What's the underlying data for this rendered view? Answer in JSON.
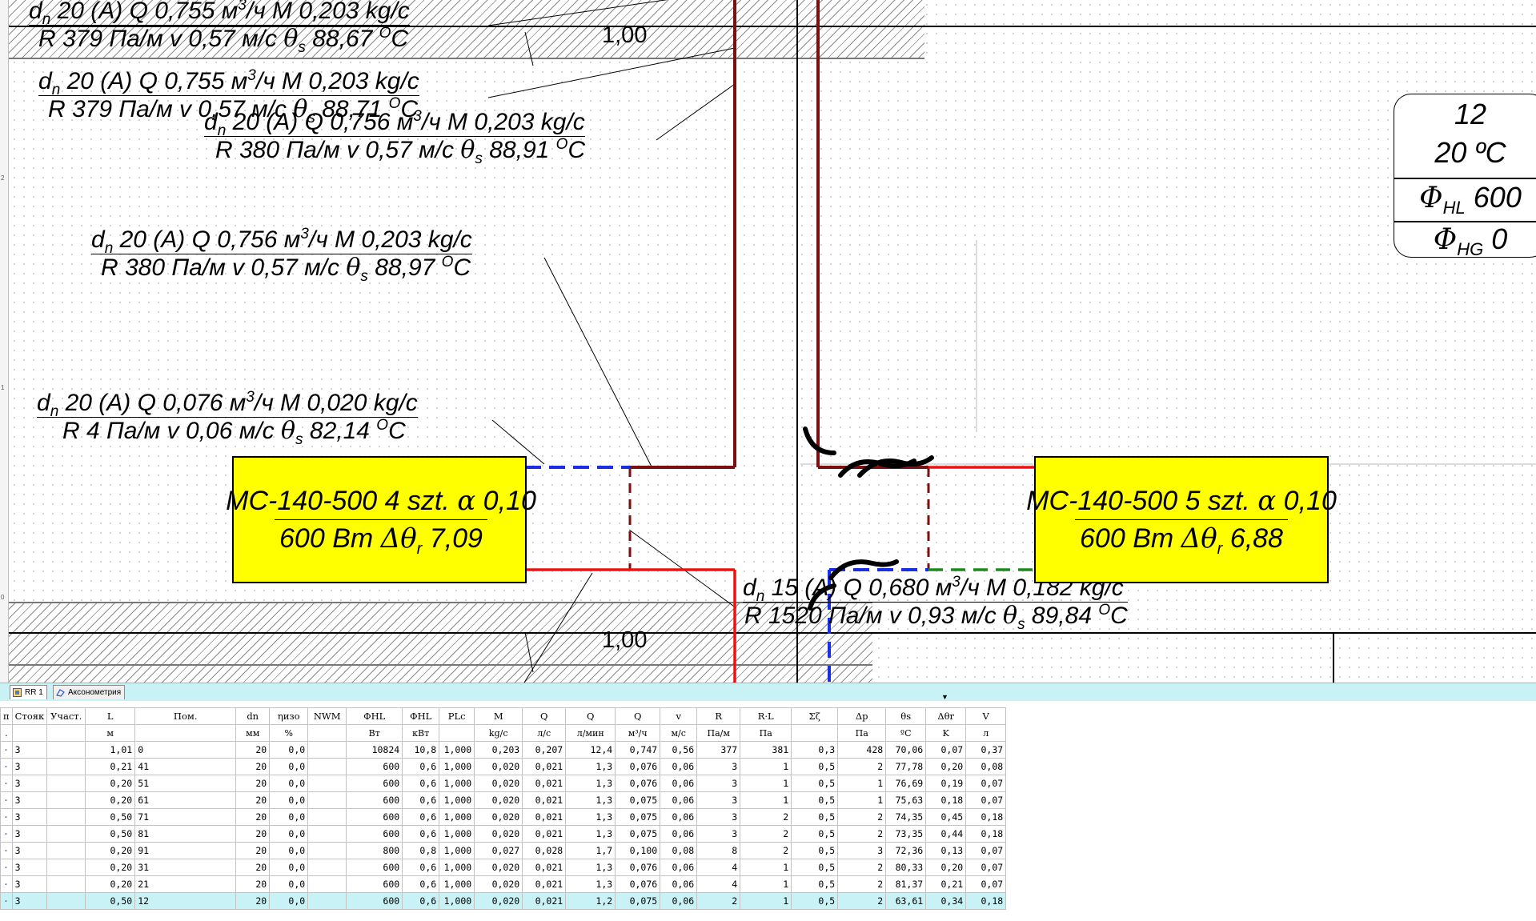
{
  "drawing": {
    "dimension_top": "1,00",
    "dimension_bottom": "1,00",
    "labels": [
      {
        "dn": "d",
        "dn_sub": "n",
        "line1_rest": " 20 (A) Q 0,755 м",
        "sup": "3",
        "line1_tail": "/ч M 0,203 kg/c",
        "line2_a": "R 379 Па/м v 0,57 м/с ",
        "theta_sub": "s",
        "line2_b": " 88,67 ",
        "deg": "O",
        "line2_c": "C"
      },
      {
        "dn": "d",
        "dn_sub": "n",
        "line1_rest": " 20 (A) Q 0,755 м",
        "sup": "3",
        "line1_tail": "/ч M 0,203 kg/c",
        "line2_a": "R 379 Па/м v 0,57 м/с ",
        "theta_sub": "s",
        "line2_b": " 88,71 ",
        "deg": "O",
        "line2_c": "C"
      },
      {
        "dn": "d",
        "dn_sub": "n",
        "line1_rest": " 20 (A) Q 0,756 м",
        "sup": "3",
        "line1_tail": "/ч M 0,203 kg/c",
        "line2_a": "R 380 Па/м v 0,57 м/с ",
        "theta_sub": "s",
        "line2_b": " 88,91 ",
        "deg": "O",
        "line2_c": "C"
      },
      {
        "dn": "d",
        "dn_sub": "n",
        "line1_rest": " 20 (A) Q 0,756 м",
        "sup": "3",
        "line1_tail": "/ч M 0,203 kg/c",
        "line2_a": "R 380 Па/м v 0,57 м/с ",
        "theta_sub": "s",
        "line2_b": " 88,97 ",
        "deg": "O",
        "line2_c": "C"
      },
      {
        "dn": "d",
        "dn_sub": "n",
        "line1_rest": " 20 (A) Q 0,076 м",
        "sup": "3",
        "line1_tail": "/ч M 0,020 kg/c",
        "line2_a": "R 4 Па/м v 0,06 м/с ",
        "theta_sub": "s",
        "line2_b": " 82,14 ",
        "deg": "O",
        "line2_c": "C"
      },
      {
        "dn": "d",
        "dn_sub": "n",
        "line1_rest": " 15 (A) Q 0,680 м",
        "sup": "3",
        "line1_tail": "/ч M 0,182 kg/c",
        "line2_a": "R 1520 Па/м v 0,93 м/с ",
        "theta_sub": "s",
        "line2_b": " 89,84 ",
        "deg": "O",
        "line2_c": "C"
      }
    ],
    "radiators": [
      {
        "line1": "MC-140-500 4 szt. ",
        "alpha": "α",
        "line1_tail": " 0,10",
        "line2": "600 Bm ",
        "delta": "Δθ",
        "delta_sub": "r",
        "line2_tail": " 7,09"
      },
      {
        "line1": "MC-140-500 5 szt. ",
        "alpha": "α",
        "line1_tail": " 0,10",
        "line2": "600 Bm ",
        "delta": "Δθ",
        "delta_sub": "r",
        "line2_tail": " 6,88"
      }
    ],
    "room_tag": {
      "number": "12",
      "temp": "20 ºC",
      "phi": "Φ",
      "phi_hl_sub": "HL",
      "phi_hl_val": " 600",
      "phi_hg_sub": "HG",
      "phi_hg_val": " 0"
    },
    "ruler_marks": [
      "2",
      "1",
      "0"
    ],
    "colors": {
      "supply": "#ee1111",
      "return": "#7a1010",
      "cold": "#1a2ee6",
      "green": "#1b8a1b",
      "radiator": "#ffff00"
    }
  },
  "tabs": [
    {
      "label": "RR 1",
      "icon": "floor-plan-icon",
      "active": true
    },
    {
      "label": "Аксонометрия",
      "icon": "axonometry-icon",
      "active": false
    }
  ],
  "table": {
    "headers": [
      "п",
      "Стояк",
      "Участ.",
      "L",
      "Пом.",
      "dn",
      "ηизо",
      "NWM",
      "ΦHL",
      "ΦHL",
      "PLc",
      "M",
      "Q",
      "Q",
      "Q",
      "v",
      "R",
      "R·L",
      "Σζ",
      "Δp",
      "θs",
      "Δθr",
      "V"
    ],
    "units": [
      ".",
      "",
      "",
      "м",
      "",
      "мм",
      "%",
      "",
      "Вт",
      "кВт",
      "",
      "kg/c",
      "л/с",
      "л/мин",
      "м³/ч",
      "м/с",
      "Па/м",
      "Па",
      "",
      "Па",
      "ºC",
      "K",
      "л"
    ],
    "rows": [
      [
        "·",
        "3",
        "",
        "1,01",
        "0",
        "20",
        "0,0",
        "",
        "10824",
        "10,8",
        "1,000",
        "0,203",
        "0,207",
        "12,4",
        "0,747",
        "0,56",
        "377",
        "381",
        "0,3",
        "428",
        "70,06",
        "0,07",
        "0,37"
      ],
      [
        "·",
        "3",
        "",
        "0,21",
        "41",
        "20",
        "0,0",
        "",
        "600",
        "0,6",
        "1,000",
        "0,020",
        "0,021",
        "1,3",
        "0,076",
        "0,06",
        "3",
        "1",
        "0,5",
        "2",
        "77,78",
        "0,20",
        "0,08"
      ],
      [
        "·",
        "3",
        "",
        "0,20",
        "51",
        "20",
        "0,0",
        "",
        "600",
        "0,6",
        "1,000",
        "0,020",
        "0,021",
        "1,3",
        "0,076",
        "0,06",
        "3",
        "1",
        "0,5",
        "1",
        "76,69",
        "0,19",
        "0,07"
      ],
      [
        "·",
        "3",
        "",
        "0,20",
        "61",
        "20",
        "0,0",
        "",
        "600",
        "0,6",
        "1,000",
        "0,020",
        "0,021",
        "1,3",
        "0,075",
        "0,06",
        "3",
        "1",
        "0,5",
        "1",
        "75,63",
        "0,18",
        "0,07"
      ],
      [
        "·",
        "3",
        "",
        "0,50",
        "71",
        "20",
        "0,0",
        "",
        "600",
        "0,6",
        "1,000",
        "0,020",
        "0,021",
        "1,3",
        "0,075",
        "0,06",
        "3",
        "2",
        "0,5",
        "2",
        "74,35",
        "0,45",
        "0,18"
      ],
      [
        "·",
        "3",
        "",
        "0,50",
        "81",
        "20",
        "0,0",
        "",
        "600",
        "0,6",
        "1,000",
        "0,020",
        "0,021",
        "1,3",
        "0,075",
        "0,06",
        "3",
        "2",
        "0,5",
        "2",
        "73,35",
        "0,44",
        "0,18"
      ],
      [
        "·",
        "3",
        "",
        "0,20",
        "91",
        "20",
        "0,0",
        "",
        "800",
        "0,8",
        "1,000",
        "0,027",
        "0,028",
        "1,7",
        "0,100",
        "0,08",
        "8",
        "2",
        "0,5",
        "3",
        "72,36",
        "0,13",
        "0,07"
      ],
      [
        "·",
        "3",
        "",
        "0,20",
        "31",
        "20",
        "0,0",
        "",
        "600",
        "0,6",
        "1,000",
        "0,020",
        "0,021",
        "1,3",
        "0,076",
        "0,06",
        "4",
        "1",
        "0,5",
        "2",
        "80,33",
        "0,20",
        "0,07"
      ],
      [
        "·",
        "3",
        "",
        "0,20",
        "21",
        "20",
        "0,0",
        "",
        "600",
        "0,6",
        "1,000",
        "0,020",
        "0,021",
        "1,3",
        "0,076",
        "0,06",
        "4",
        "1",
        "0,5",
        "2",
        "81,37",
        "0,21",
        "0,07"
      ],
      [
        "·",
        "3",
        "",
        "0,50",
        "12",
        "20",
        "0,0",
        "",
        "600",
        "0,6",
        "1,000",
        "0,020",
        "0,021",
        "1,2",
        "0,075",
        "0,06",
        "2",
        "1",
        "0,5",
        "2",
        "63,61",
        "0,34",
        "0,18"
      ]
    ],
    "selected_row": 9
  }
}
